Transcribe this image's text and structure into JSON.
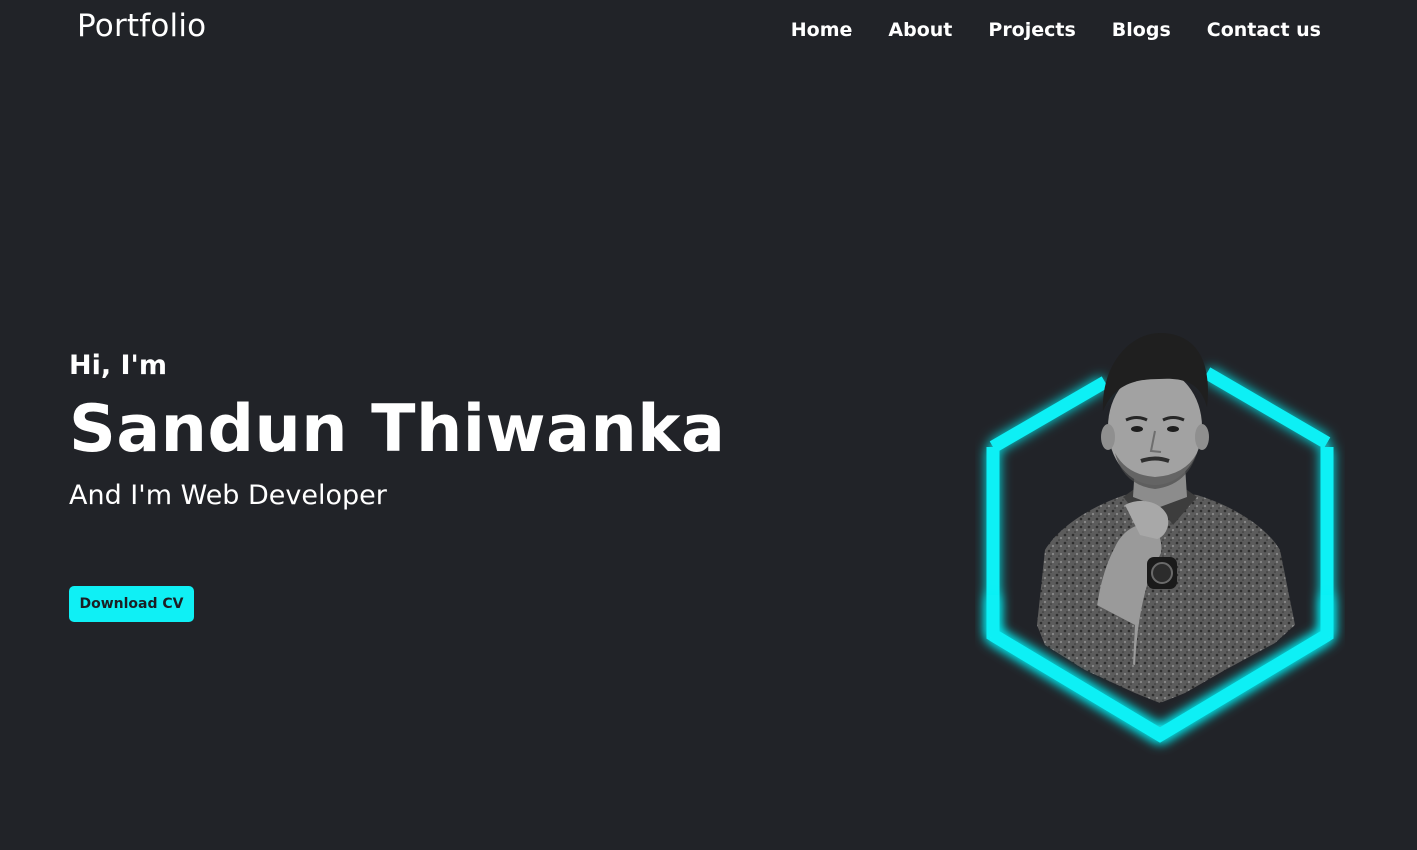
{
  "navbar": {
    "brand": "Portfolio",
    "links": [
      "Home",
      "About",
      "Projects",
      "Blogs",
      "Contact us"
    ]
  },
  "hero": {
    "greeting": "Hi, I'm",
    "name": "Sandun Thiwanka",
    "role": "And I'm Web Developer",
    "cta_label": "Download CV"
  },
  "colors": {
    "background": "#212328",
    "accent": "#0ff0f5",
    "text": "#ffffff"
  },
  "icons": [
    "hexagon-frame",
    "profile-photo"
  ]
}
